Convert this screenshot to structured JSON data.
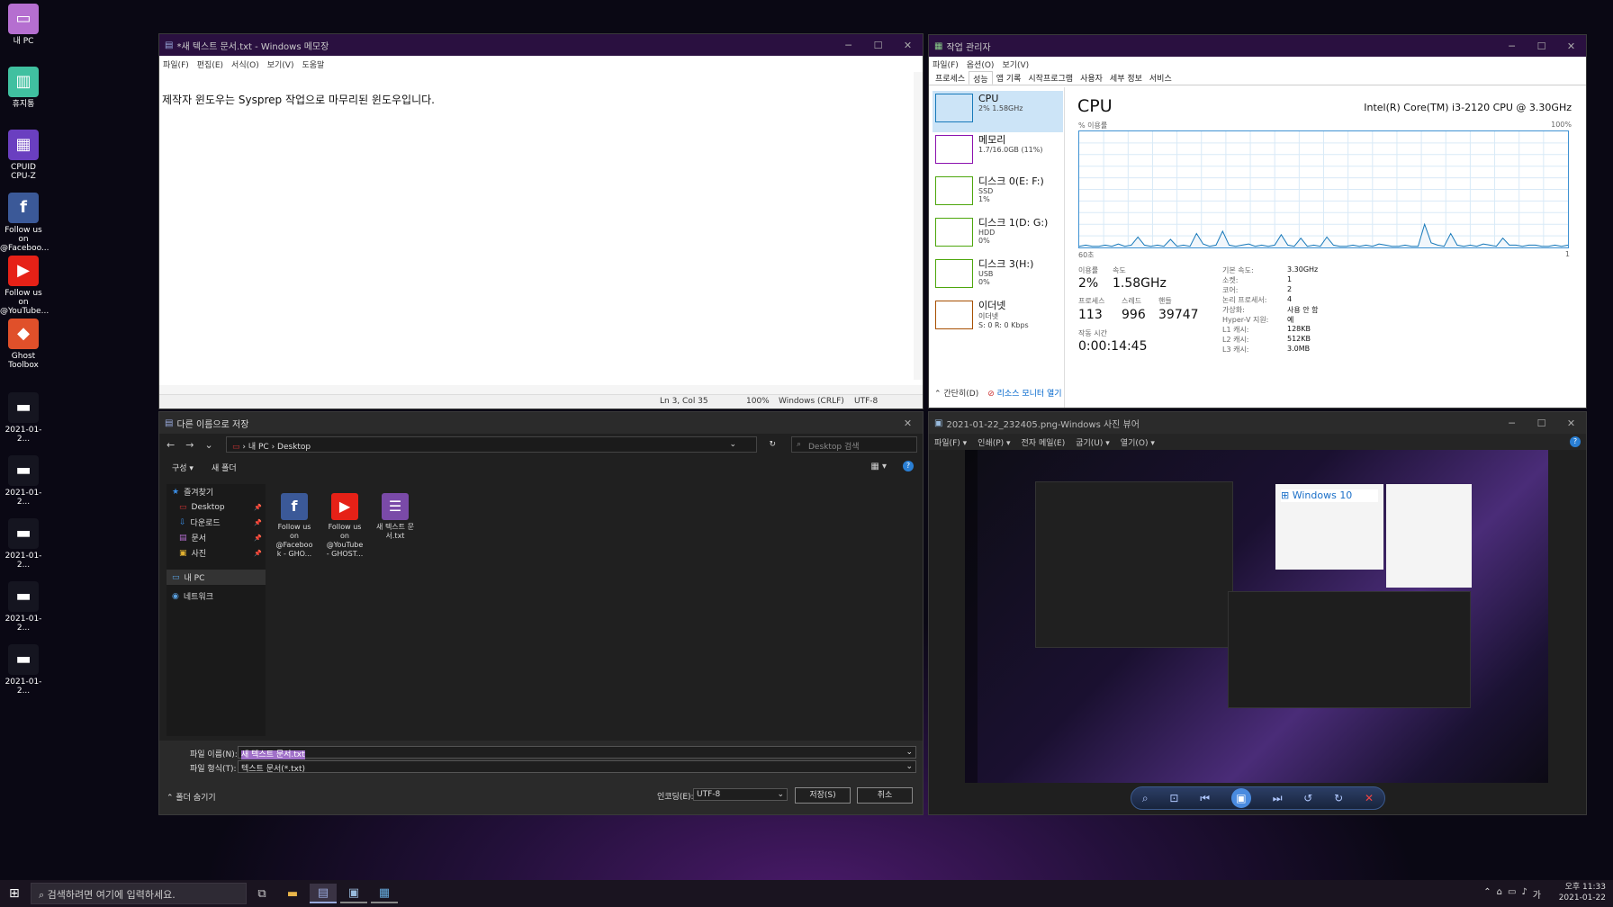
{
  "desktop": {
    "icons": [
      {
        "label": "내 PC",
        "icon": "monitor-icon"
      },
      {
        "label": "휴지통",
        "icon": "trash-icon"
      },
      {
        "label": "CPUID CPU-Z",
        "icon": "cpuz-icon"
      },
      {
        "label": "Follow us on @Faceboo...",
        "icon": "facebook-icon"
      },
      {
        "label": "Follow us on @YouTube...",
        "icon": "youtube-icon"
      },
      {
        "label": "Ghost Toolbox",
        "icon": "ghost-toolbox-icon"
      },
      {
        "label": "2021-01-2...",
        "icon": "image-file-icon"
      },
      {
        "label": "2021-01-2...",
        "icon": "image-file-icon"
      },
      {
        "label": "2021-01-2...",
        "icon": "image-file-icon"
      },
      {
        "label": "2021-01-2...",
        "icon": "image-file-icon"
      },
      {
        "label": "2021-01-2...",
        "icon": "image-file-icon"
      }
    ]
  },
  "notepad": {
    "title": "*새 텍스트 문서.txt - Windows 메모장",
    "menu": [
      "파일(F)",
      "편집(E)",
      "서식(O)",
      "보기(V)",
      "도움말"
    ],
    "content": "제작자 윈도우는 Sysprep 작업으로 마무리된 윈도우입니다.",
    "status": {
      "position": "Ln 3, Col 35",
      "zoom": "100%",
      "eol": "Windows (CRLF)",
      "encoding": "UTF-8"
    }
  },
  "taskmgr": {
    "title": "작업 관리자",
    "menu": [
      "파일(F)",
      "옵션(O)",
      "보기(V)"
    ],
    "tabs": [
      "프로세스",
      "성능",
      "앱 기록",
      "시작프로그램",
      "사용자",
      "세부 정보",
      "서비스"
    ],
    "active_tab": "성능",
    "perf_items": [
      {
        "name": "CPU",
        "sub1": "2% 1.58GHz",
        "sub2": "",
        "sub3": "",
        "color": "#1779ba"
      },
      {
        "name": "메모리",
        "sub1": "1.7/16.0GB (11%)",
        "sub2": "",
        "sub3": "",
        "color": "#8b12ae"
      },
      {
        "name": "디스크 0(E: F:)",
        "sub1": "SSD",
        "sub2": "1%",
        "sub3": "",
        "color": "#4da60c"
      },
      {
        "name": "디스크 1(D: G:)",
        "sub1": "HDD",
        "sub2": "0%",
        "sub3": "",
        "color": "#4da60c"
      },
      {
        "name": "디스크 3(H:)",
        "sub1": "USB",
        "sub2": "0%",
        "sub3": "",
        "color": "#4da60c"
      },
      {
        "name": "이더넷",
        "sub1": "이더넷",
        "sub2": "S: 0 R: 0 Kbps",
        "sub3": "",
        "color": "#a74f01"
      }
    ],
    "cpu_title": "CPU",
    "cpu_model": "Intel(R) Core(TM) i3-2120 CPU @ 3.30GHz",
    "graph_ylabel": "% 이용률",
    "graph_ymax": "100%",
    "graph_xleft": "60초",
    "graph_xright": "1",
    "stats": {
      "util_label": "이용률",
      "util": "2%",
      "speed_label": "속도",
      "speed": "1.58GHz",
      "proc_label": "프로세스",
      "proc": "113",
      "thread_label": "스레드",
      "thread": "996",
      "handle_label": "핸들",
      "handle": "39747",
      "uptime_label": "작동 시간",
      "uptime": "0:00:14:45"
    },
    "specs": [
      {
        "k": "기본 속도:",
        "v": "3.30GHz"
      },
      {
        "k": "소켓:",
        "v": "1"
      },
      {
        "k": "코어:",
        "v": "2"
      },
      {
        "k": "논리 프로세서:",
        "v": "4"
      },
      {
        "k": "가상화:",
        "v": "사용 안 함"
      },
      {
        "k": "Hyper-V 지원:",
        "v": "예"
      },
      {
        "k": "L1 캐시:",
        "v": "128KB"
      },
      {
        "k": "L2 캐시:",
        "v": "512KB"
      },
      {
        "k": "L3 캐시:",
        "v": "3.0MB"
      }
    ],
    "footer_brief": "간단히(D)",
    "footer_resmon": "리소스 모니터 열기",
    "cpu_series": [
      1,
      2,
      1,
      1,
      2,
      1,
      3,
      1,
      2,
      9,
      2,
      1,
      2,
      1,
      7,
      1,
      2,
      1,
      12,
      3,
      1,
      2,
      14,
      2,
      1,
      2,
      3,
      1,
      2,
      1,
      2,
      11,
      2,
      1,
      8,
      1,
      2,
      1,
      9,
      2,
      1,
      1,
      2,
      1,
      2,
      1,
      3,
      2,
      1,
      1,
      2,
      1,
      1,
      20,
      4,
      2,
      1,
      12,
      2,
      1,
      2,
      1,
      3,
      2,
      1,
      8,
      2,
      2,
      1,
      2,
      2,
      1,
      1,
      2,
      1,
      2
    ]
  },
  "savedlg": {
    "title": "다른 이름으로 저장",
    "breadcrumb": [
      "내 PC",
      "Desktop"
    ],
    "search_placeholder": "Desktop 검색",
    "organize": "구성 ▾",
    "new_folder": "새 폴더",
    "nav": [
      {
        "label": "즐겨찾기",
        "icon": "star-icon"
      },
      {
        "label": "Desktop",
        "icon": "desktop-folder-icon"
      },
      {
        "label": "다운로드",
        "icon": "download-icon"
      },
      {
        "label": "문서",
        "icon": "documents-icon"
      },
      {
        "label": "사진",
        "icon": "pictures-icon"
      },
      {
        "label": "내 PC",
        "icon": "pc-icon"
      },
      {
        "label": "네트워크",
        "icon": "network-icon"
      }
    ],
    "files": [
      {
        "label": "Follow us on @Faceboo k - GHO...",
        "icon": "facebook-icon"
      },
      {
        "label": "Follow us on @YouTube - GHOST...",
        "icon": "youtube-icon"
      },
      {
        "label": "새 텍스트 문서.txt",
        "icon": "text-file-icon"
      }
    ],
    "filename_label": "파일 이름(N):",
    "filename": "새 텍스트 문서.txt",
    "filetype_label": "파일 형식(T):",
    "filetype": "텍스트 문서(*.txt)",
    "hide_folders": "폴더 숨기기",
    "encoding_label": "인코딩(E):",
    "encoding": "UTF-8",
    "save": "저장(S)",
    "cancel": "취소"
  },
  "photoview": {
    "title": "2021-01-22_232405.png-Windows 사진 뷰어",
    "menu": [
      "파일(F) ▾",
      "인쇄(P) ▾",
      "전자 메일(E)",
      "굽기(U) ▾",
      "열기(O) ▾"
    ]
  },
  "taskbar": {
    "search_placeholder": "검색하려면 여기에 입력하세요.",
    "time": "오후 11:33",
    "date": "2021-01-22"
  }
}
